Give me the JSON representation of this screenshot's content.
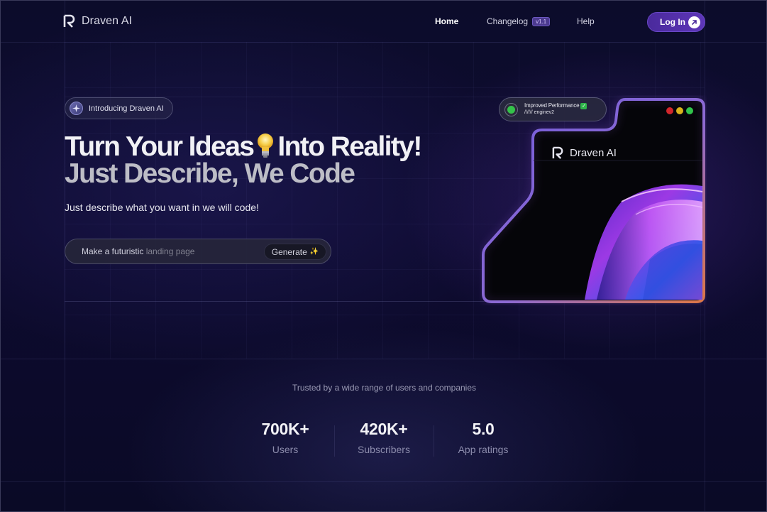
{
  "header": {
    "brand_name": "Draven AI",
    "nav": {
      "home": "Home",
      "changelog": "Changelog",
      "changelog_badge": "v1.1",
      "help": "Help"
    },
    "login_label": "Log In"
  },
  "hero": {
    "intro_badge": "Introducing Draven AI",
    "headline_part1": "Turn Your Ideas",
    "headline_part2": "Into Reality!",
    "subheadline": "Just Describe, We Code",
    "description": "Just describe what you want in we will code!",
    "prompt": {
      "typed": "Make a futuristic ",
      "placeholder_rest": "landing page",
      "generate_label": "Generate"
    }
  },
  "preview": {
    "status_title": "Improved Performance",
    "status_sub": "////// enginev2",
    "brand_name": "Draven AI",
    "window_dots": [
      "#d2262b",
      "#d9b41c",
      "#31c44b"
    ]
  },
  "stats": {
    "trusted_text": "Trusted by a wide range of users and companies",
    "items": [
      {
        "value": "700K+",
        "label": "Users"
      },
      {
        "value": "420K+",
        "label": "Subscribers"
      },
      {
        "value": "5.0",
        "label": "App ratings"
      }
    ]
  },
  "colors": {
    "accent": "#5a34b4",
    "background": "#0c0c2b"
  }
}
